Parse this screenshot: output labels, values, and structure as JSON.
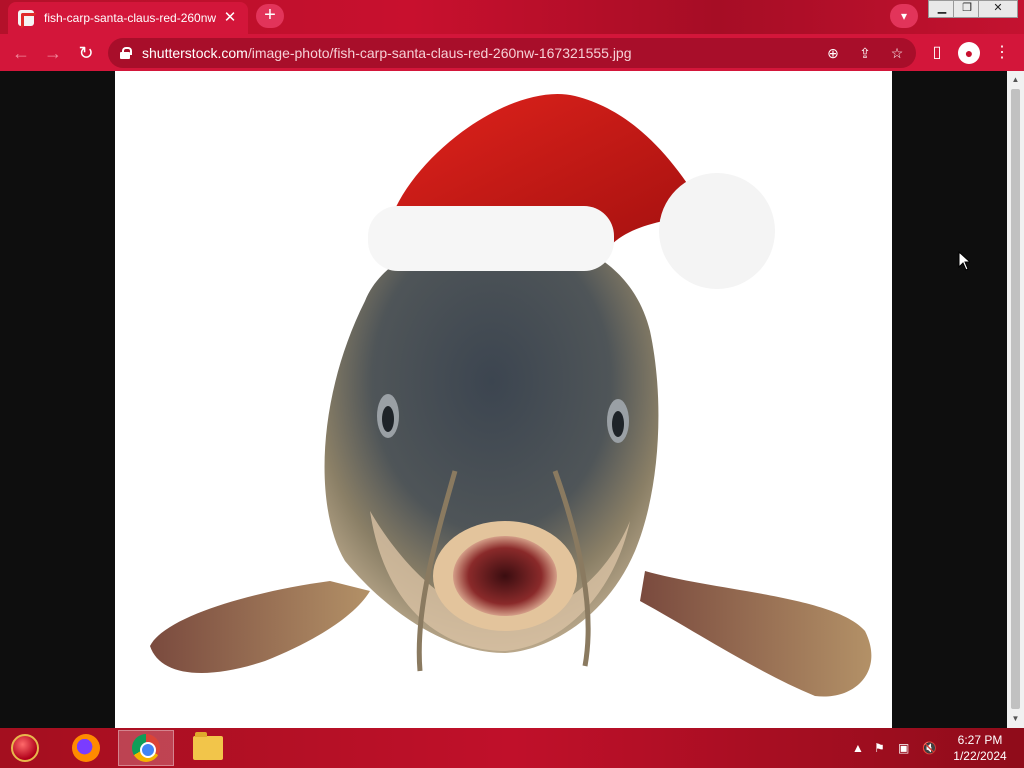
{
  "browser": {
    "tab_title": "fish-carp-santa-claus-red-260nw",
    "tab_close": "✕",
    "new_tab": "+",
    "url_host": "shutterstock.com",
    "url_path": "/image-photo/fish-carp-santa-claus-red-260nw-167321555.jpg",
    "accent_color": "#d3163a"
  },
  "taskbar": {
    "time": "6:27 PM",
    "date": "1/22/2024"
  }
}
